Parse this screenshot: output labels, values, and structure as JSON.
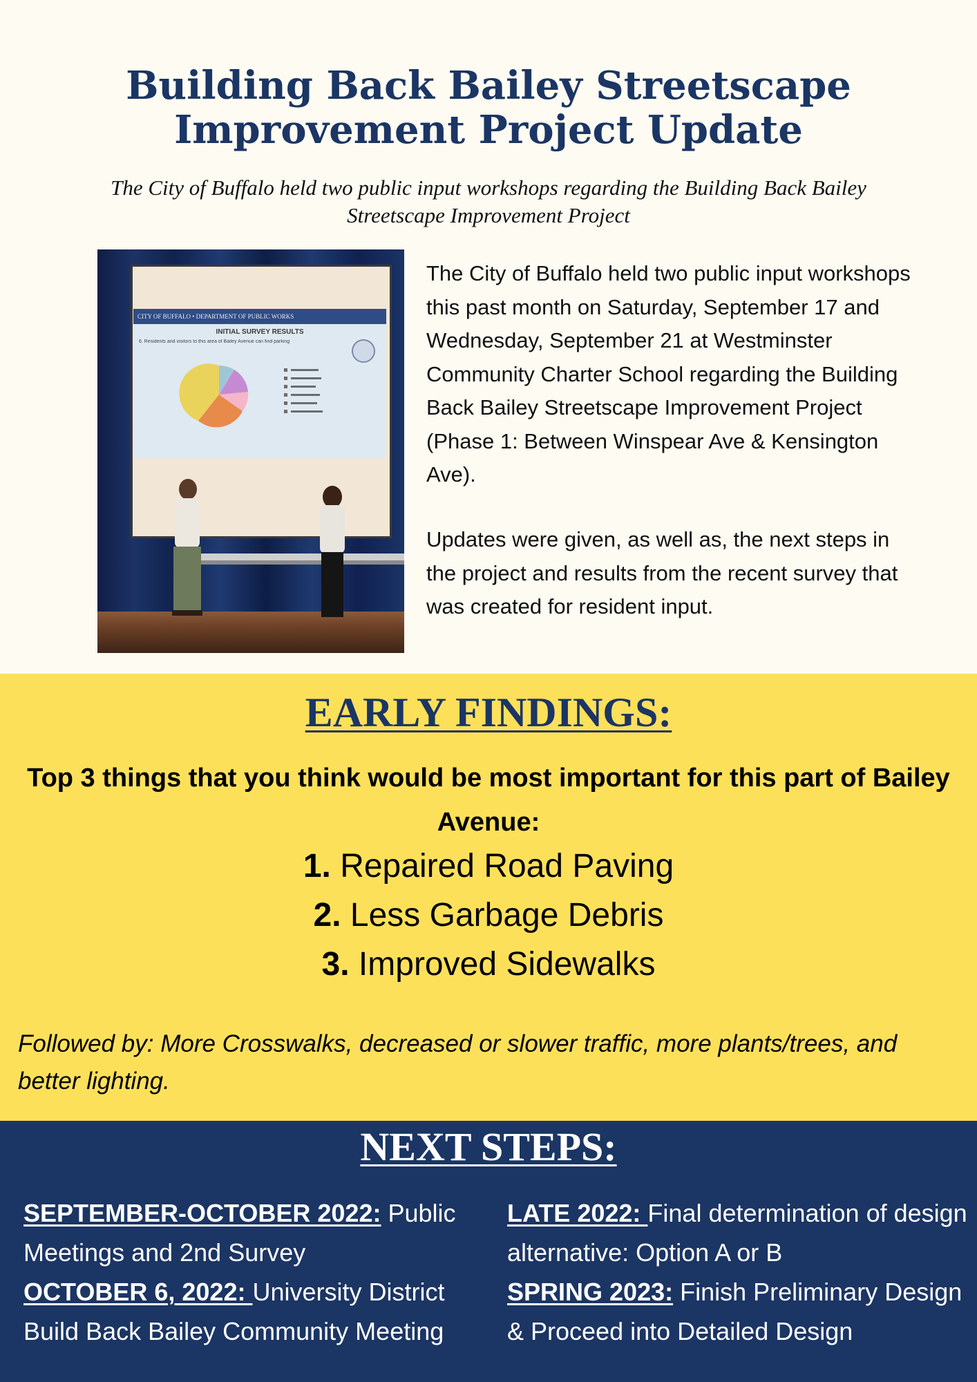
{
  "header": {
    "title_line1": "Building Back Bailey Streetscape",
    "title_line2": "Improvement Project Update",
    "subtitle": "The City of Buffalo held two public input workshops regarding the Building Back Bailey Streetscape Improvement Project"
  },
  "photo": {
    "slide_header": "CITY OF BUFFALO • DEPARTMENT OF PUBLIC WORKS",
    "slide_title": "INITIAL SURVEY RESULTS",
    "slide_question": "6. Residents and visitors to this area of Bailey Avenue can find parking",
    "pie_colors": [
      "#e9d35a",
      "#e88a4a",
      "#9fc6d6",
      "#c68ad2",
      "#f4b6c8"
    ]
  },
  "intro": {
    "paragraph1": "The City of Buffalo held two  public input workshops this past month on Saturday, September 17 and Wednesday, September 21 at Westminster Community Charter School regarding the Building Back Bailey Streetscape Improvement Project (Phase 1: Between Winspear Ave & Kensington Ave).",
    "paragraph2": "Updates were given, as well as, the next steps in the project and results from the recent survey that was created for resident input."
  },
  "findings": {
    "heading": "EARLY FINDINGS:",
    "question": "Top 3 things that you think would be most important for this part of Bailey Avenue:",
    "items": [
      {
        "num": "1.",
        "text": "Repaired Road Paving"
      },
      {
        "num": "2.",
        "text": "Less Garbage Debris"
      },
      {
        "num": "3.",
        "text": "Improved Sidewalks"
      }
    ],
    "followed_by": "Followed by: More Crosswalks, decreased or slower traffic, more plants/trees, and better lighting."
  },
  "next_steps": {
    "heading": "NEXT STEPS:",
    "left": [
      {
        "label": "SEPTEMBER-OCTOBER 2022:",
        "text": "Public Meetings and 2nd Survey"
      },
      {
        "label": "OCTOBER 6, 2022: ",
        "text": "University District Build Back Bailey Community Meeting"
      }
    ],
    "right": [
      {
        "label": "LATE 2022: ",
        "text": "Final determination of design alternative: Option A or B"
      },
      {
        "label": "SPRING 2023:",
        "text": "Finish Preliminary Design & Proceed into Detailed Design"
      }
    ]
  },
  "colors": {
    "navy": "#1b3564",
    "yellow": "#fde05a",
    "cream": "#fdfbf2"
  }
}
